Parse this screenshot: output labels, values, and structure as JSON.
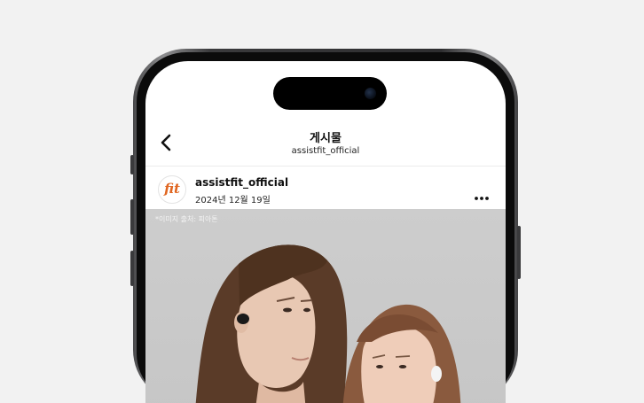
{
  "header": {
    "title": "게시물",
    "subtitle": "assistfit_official"
  },
  "post": {
    "author": "assistfit_official",
    "date": "2024년 12월 19일",
    "avatar_logo_text": "fit",
    "image_caption": "*이미지 출처: 피아톤"
  },
  "icons": {
    "back": "chevron-left-icon",
    "more": "more-horizontal-icon"
  },
  "colors": {
    "brand_orange": "#e0651f",
    "background": "#f2f2f2"
  }
}
